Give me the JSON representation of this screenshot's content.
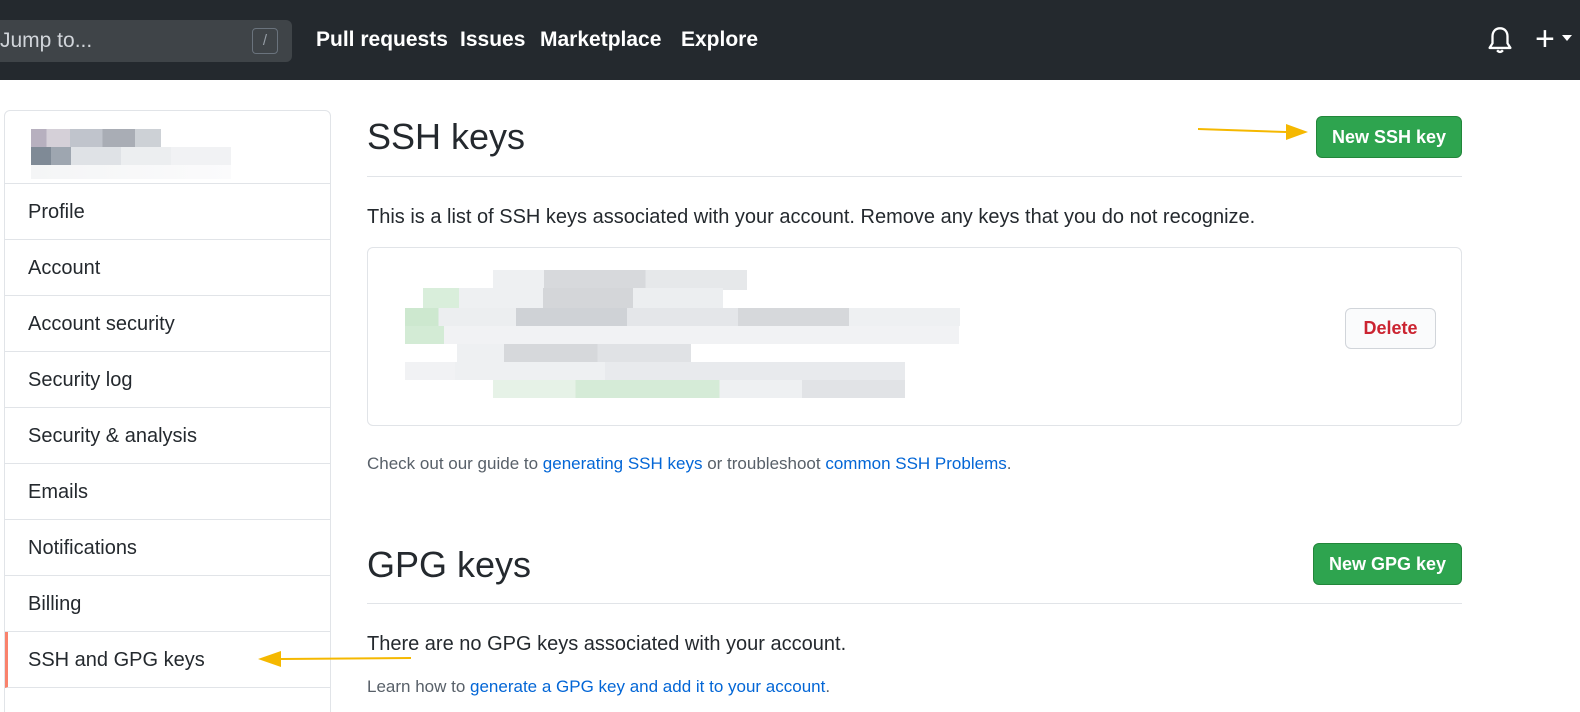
{
  "topbar": {
    "search_placeholder": "Jump to...",
    "search_shortcut": "/",
    "nav": [
      "Pull requests",
      "Issues",
      "Marketplace",
      "Explore"
    ],
    "plus_label": "+"
  },
  "sidebar": {
    "items": [
      "Profile",
      "Account",
      "Account security",
      "Security log",
      "Security & analysis",
      "Emails",
      "Notifications",
      "Billing",
      "SSH and GPG keys"
    ],
    "active_item": "SSH and GPG keys"
  },
  "ssh": {
    "title": "SSH keys",
    "new_button": "New SSH key",
    "description": "This is a list of SSH keys associated with your account. Remove any keys that you do not recognize.",
    "delete_button": "Delete",
    "guide_prefix": "Check out our guide to ",
    "guide_link1": "generating SSH keys",
    "guide_middle": " or troubleshoot ",
    "guide_link2": "common SSH Problems",
    "guide_suffix": "."
  },
  "gpg": {
    "title": "GPG keys",
    "new_button": "New GPG key",
    "empty_text": "There are no GPG keys associated with your account.",
    "learn_prefix": "Learn how to ",
    "learn_link": "generate a GPG key and add it to your account",
    "learn_suffix": "."
  },
  "colors": {
    "header_bg": "#24292e",
    "primary_green": "#2ea44f",
    "link_blue": "#0366d6",
    "danger_red": "#cb2431",
    "active_indicator": "#f9826c",
    "annotation_arrow": "#f5b800"
  },
  "icons": [
    "bell-icon",
    "plus-icon",
    "chevron-down-icon"
  ]
}
